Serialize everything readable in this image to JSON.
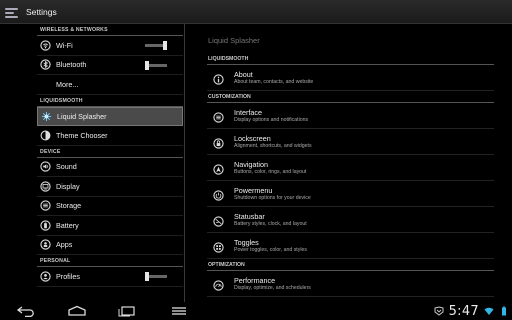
{
  "app": {
    "title": "Settings"
  },
  "left": {
    "sections": [
      {
        "header": "WIRELESS & NETWORKS",
        "items": [
          {
            "label": "Wi-Fi",
            "icon": "wifi-icon",
            "switch": "on"
          },
          {
            "label": "Bluetooth",
            "icon": "bluetooth-icon",
            "switch": "off"
          },
          {
            "label": "More...",
            "icon": "",
            "switch": ""
          }
        ]
      },
      {
        "header": "LIQUIDSMOOTH",
        "items": [
          {
            "label": "Liquid Splasher",
            "icon": "splash-icon",
            "selected": true
          },
          {
            "label": "Theme Chooser",
            "icon": "theme-icon"
          }
        ]
      },
      {
        "header": "DEVICE",
        "items": [
          {
            "label": "Sound",
            "icon": "sound-icon"
          },
          {
            "label": "Display",
            "icon": "display-icon"
          },
          {
            "label": "Storage",
            "icon": "storage-icon"
          },
          {
            "label": "Battery",
            "icon": "battery-icon"
          },
          {
            "label": "Apps",
            "icon": "apps-icon"
          }
        ]
      },
      {
        "header": "PERSONAL",
        "items": [
          {
            "label": "Profiles",
            "icon": "profiles-icon",
            "switch": "off"
          }
        ]
      }
    ]
  },
  "right": {
    "title": "Liquid Splasher",
    "sections": [
      {
        "header": "LIQUIDSMOOTH",
        "items": [
          {
            "title": "About",
            "subtitle": "About team, contacts, and website",
            "icon": "info-icon"
          }
        ]
      },
      {
        "header": "CUSTOMIZATION",
        "items": [
          {
            "title": "Interface",
            "subtitle": "Display options and notifications",
            "icon": "interface-icon"
          },
          {
            "title": "Lockscreen",
            "subtitle": "Alignment, shortcuts, and widgets",
            "icon": "lock-icon"
          },
          {
            "title": "Navigation",
            "subtitle": "Buttons, color, rings, and layout",
            "icon": "navigation-icon"
          },
          {
            "title": "Powermenu",
            "subtitle": "Shutdown options for your device",
            "icon": "power-icon"
          },
          {
            "title": "Statusbar",
            "subtitle": "Battery styles, clock, and layout",
            "icon": "statusbar-icon"
          },
          {
            "title": "Toggles",
            "subtitle": "Power toggles, color, and styles",
            "icon": "toggles-icon"
          }
        ]
      },
      {
        "header": "OPTIMIZATION",
        "items": [
          {
            "title": "Performance",
            "subtitle": "Display, optimize, and schedulers",
            "icon": "performance-icon"
          }
        ]
      }
    ]
  },
  "navbar": {
    "clock": "5:47"
  },
  "colors": {
    "background": "#000000",
    "accent": "#33b5e5",
    "text": "#eeeeee"
  }
}
